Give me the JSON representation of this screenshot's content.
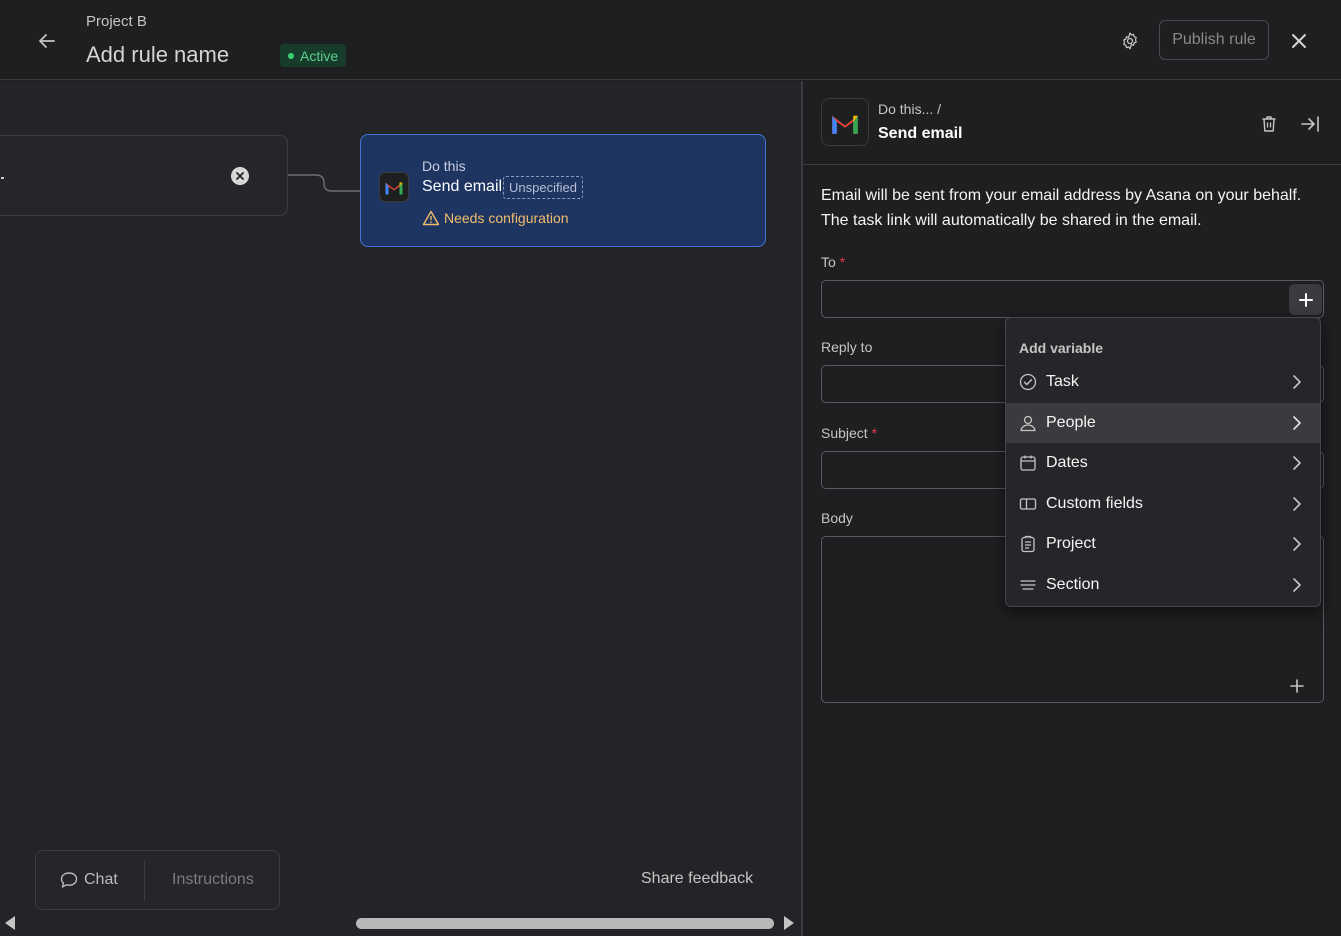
{
  "header": {
    "project": "Project B",
    "rule_name": "Add rule name",
    "status": "Active",
    "publish_label": "Publish rule"
  },
  "canvas": {
    "trigger_text": ".",
    "action": {
      "label": "Do this",
      "title": "Send email",
      "chip": "Unspecified",
      "warning": "Needs configuration"
    },
    "chat_label": "Chat",
    "instructions_label": "Instructions",
    "share_feedback": "Share feedback"
  },
  "panel": {
    "breadcrumb": "Do this...  /",
    "title": "Send email",
    "description": "Email will be sent from your email address by Asana on your behalf. The task link will automatically be shared in the email.",
    "fields": {
      "to": "To",
      "reply_to": "Reply to",
      "subject": "Subject",
      "body": "Body"
    },
    "required_marker": "*"
  },
  "dropdown": {
    "heading": "Add variable",
    "items": [
      {
        "label": "Task",
        "icon": "check-circle-icon",
        "active": false
      },
      {
        "label": "People",
        "icon": "person-icon",
        "active": true
      },
      {
        "label": "Dates",
        "icon": "calendar-icon",
        "active": false
      },
      {
        "label": "Custom fields",
        "icon": "custom-field-icon",
        "active": false
      },
      {
        "label": "Project",
        "icon": "clipboard-icon",
        "active": false
      },
      {
        "label": "Section",
        "icon": "section-icon",
        "active": false
      }
    ]
  },
  "colors": {
    "accent": "#4573d2",
    "active_green": "#5ecf8d",
    "warning": "#f1bd6c",
    "required": "#e8384f"
  }
}
